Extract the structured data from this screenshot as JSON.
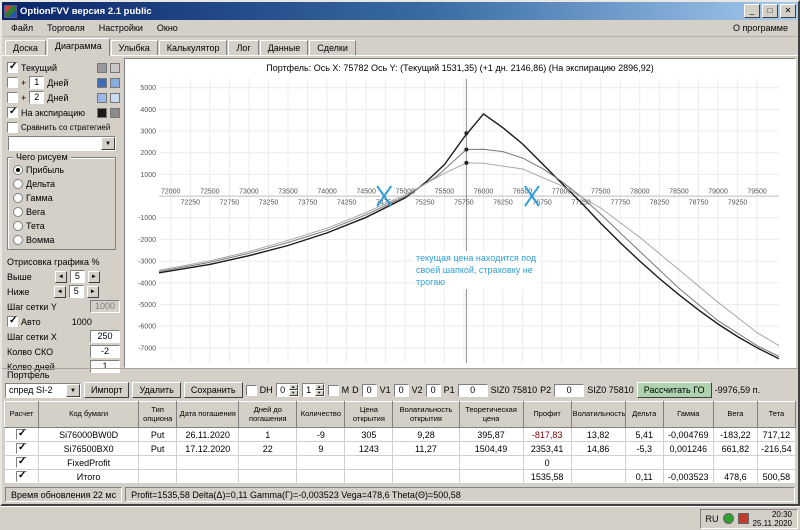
{
  "titlebar": {
    "title": "OptionFVV версия 2.1 public",
    "buttons": {
      "minimize": "_",
      "maximize": "□",
      "close": "✕"
    }
  },
  "menubar": {
    "items": [
      "Файл",
      "Торговля",
      "Настройки",
      "Окно"
    ],
    "right": "О программе"
  },
  "tabs": {
    "items": [
      "Доска",
      "Диаграмма",
      "Улыбка",
      "Калькулятор",
      "Лог",
      "Данные",
      "Сделки"
    ],
    "active": "Диаграмма"
  },
  "sidebar": {
    "rows": {
      "current": {
        "label": "Текущий",
        "checked": true,
        "colors": [
          "#9a9a9a",
          "#c8c8c8"
        ]
      },
      "plus1": {
        "label": "+",
        "value": "1",
        "suffix": "Дней",
        "checked": false,
        "colors": [
          "#3c6cb4",
          "#86aede"
        ]
      },
      "plus2": {
        "label": "+",
        "value": "2",
        "suffix": "Дней",
        "checked": false,
        "colors": [
          "#9ab8e4",
          "#c9dcf3"
        ]
      },
      "expiration": {
        "label": "На экспирацию",
        "checked": true,
        "colors": [
          "#1a1a1a",
          "#8a8a8a"
        ]
      },
      "compare": {
        "label": "Сравнить со стратегией",
        "checked": false
      }
    },
    "draw": {
      "title": "Чего рисуем",
      "options": [
        "Прибыль",
        "Дельта",
        "Гамма",
        "Вега",
        "Тета",
        "Вомма"
      ],
      "selected": "Прибыль"
    },
    "render_pct": {
      "title": "Отрисовка графика %",
      "above": {
        "label": "Выше",
        "value": "5"
      },
      "below": {
        "label": "Ниже",
        "value": "5"
      }
    },
    "grid_y": {
      "label": "Шаг сетки Y",
      "value": "1000"
    },
    "auto": {
      "label": "Авто",
      "checked": true,
      "value": "1000"
    },
    "grid_x": {
      "label": "Шаг сетки X",
      "value": "250"
    },
    "sko": {
      "label": "Колво СКО",
      "value": "-2"
    },
    "days": {
      "label": "Колво дней",
      "value": "1"
    }
  },
  "chart": {
    "title": "Портфель:  Ось X: 75782  Ось Y:   (Текущий 1531,35)   (+1 дн. 2146,86)   (На экспирацию 2896,92)",
    "x_range": [
      71850,
      79780
    ],
    "y_range": [
      -7700,
      5400
    ],
    "x_ticks": {
      "start": 72000,
      "end": 79500,
      "step": 250
    },
    "y_ticks": [
      5000,
      4000,
      3000,
      2000,
      1000,
      -1000,
      -2000,
      -3000,
      -4000,
      -5000,
      -6000,
      -7000
    ],
    "current_x": 75782,
    "cross_marks_x": [
      74730,
      76620
    ],
    "accent_color": "#2e9ed8",
    "annotation": [
      "текущая цена находится под",
      "своей шапкой, страховку не",
      "трогаю"
    ],
    "series": [
      {
        "name": "на экспирацию",
        "color": "#1a1a1a",
        "width": 1.4,
        "points": [
          [
            71850,
            -3540
          ],
          [
            72500,
            -3150
          ],
          [
            73000,
            -2750
          ],
          [
            73500,
            -2280
          ],
          [
            74000,
            -1700
          ],
          [
            74500,
            -980
          ],
          [
            75000,
            -80
          ],
          [
            75250,
            600
          ],
          [
            75500,
            1450
          ],
          [
            75750,
            2700
          ],
          [
            76000,
            3790
          ],
          [
            76250,
            3150
          ],
          [
            76500,
            2400
          ],
          [
            76750,
            1500
          ],
          [
            77000,
            600
          ],
          [
            77250,
            -300
          ],
          [
            77500,
            -1250
          ],
          [
            77750,
            -2150
          ],
          [
            78000,
            -3000
          ],
          [
            78250,
            -3800
          ],
          [
            78500,
            -4550
          ],
          [
            78750,
            -5250
          ],
          [
            79000,
            -5900
          ],
          [
            79250,
            -6480
          ],
          [
            79500,
            -7000
          ],
          [
            79780,
            -7500
          ]
        ]
      },
      {
        "name": "+1 день",
        "color": "#787878",
        "width": 1,
        "points": [
          [
            71850,
            -3480
          ],
          [
            72500,
            -3060
          ],
          [
            73000,
            -2640
          ],
          [
            73500,
            -2140
          ],
          [
            74000,
            -1580
          ],
          [
            74500,
            -860
          ],
          [
            75000,
            -20
          ],
          [
            75400,
            900
          ],
          [
            75782,
            2147
          ],
          [
            76000,
            2160
          ],
          [
            76250,
            2050
          ],
          [
            76500,
            1750
          ],
          [
            76750,
            1280
          ],
          [
            77000,
            680
          ],
          [
            77250,
            -30
          ],
          [
            77500,
            -830
          ],
          [
            78000,
            -2550
          ],
          [
            78500,
            -4250
          ],
          [
            79000,
            -5750
          ],
          [
            79500,
            -6900
          ],
          [
            79780,
            -7400
          ]
        ]
      },
      {
        "name": "текущий",
        "color": "#a8a8a8",
        "width": 1,
        "points": [
          [
            71850,
            -3420
          ],
          [
            72500,
            -2990
          ],
          [
            73000,
            -2560
          ],
          [
            73500,
            -2040
          ],
          [
            74000,
            -1480
          ],
          [
            74500,
            -760
          ],
          [
            75000,
            60
          ],
          [
            75500,
            1050
          ],
          [
            75782,
            1531
          ],
          [
            76000,
            1510
          ],
          [
            76500,
            1250
          ],
          [
            77000,
            480
          ],
          [
            77500,
            -550
          ],
          [
            78000,
            -1900
          ],
          [
            78500,
            -3400
          ],
          [
            79000,
            -4900
          ],
          [
            79500,
            -6300
          ],
          [
            79780,
            -6900
          ]
        ]
      }
    ],
    "dots": [
      [
        75782,
        1531
      ],
      [
        75782,
        2147
      ],
      [
        75782,
        2897
      ]
    ]
  },
  "portfolio": {
    "label": "Портфель",
    "toolbar": {
      "preset": "спред SI-2",
      "import": "Импорт",
      "delete": "Удалить",
      "save": "Сохранить",
      "dh_label": "DH",
      "spin1": "0",
      "spin2": "1",
      "m_label": "M",
      "d_label": "D",
      "d_value": "0",
      "v1_label": "V1",
      "v1_value": "0",
      "v2_label": "V2",
      "v2_value": "0",
      "p1_label": "P1",
      "p1_value": "0",
      "p1_info": "SIZ0 75810",
      "p2_label": "P2",
      "p2_value": "0",
      "p2_info": "SIZ0 75810",
      "calc_go": "Рассчитать ГО",
      "go_value": "-9976,59 п."
    },
    "table": {
      "columns": [
        "Расчет",
        "Код бумаги",
        "Тип опциона",
        "Дата погашения",
        "Дней до погашения",
        "Количество",
        "Цена открытия",
        "Волатильность открытия",
        "Теоретическая цена",
        "Профит",
        "Волатильность",
        "Дельта",
        "Гамма",
        "Вега",
        "Тета"
      ],
      "rows": [
        {
          "checked": true,
          "profit_state": "negative",
          "cells": [
            "Si76000BW0D",
            "Put",
            "26.11.2020",
            "1",
            "-9",
            "305",
            "9,28",
            "395,87",
            "-817,83",
            "13,82",
            "5,41",
            "-0,004769",
            "-183,22",
            "717,12"
          ]
        },
        {
          "checked": true,
          "profit_state": "positive",
          "cells": [
            "Si76500BX0",
            "Put",
            "17.12.2020",
            "22",
            "9",
            "1243",
            "11,27",
            "1504,49",
            "2353,41",
            "14,86",
            "-5,3",
            "0,001246",
            "661,82",
            "-216,54"
          ]
        },
        {
          "checked": true,
          "profit_state": "none",
          "cells": [
            "FixedProfit",
            "",
            "",
            "",
            "",
            "",
            "",
            "",
            "0",
            "",
            "",
            "",
            "",
            ""
          ]
        },
        {
          "checked": true,
          "profit_state": "positive",
          "cells": [
            "Итого",
            "",
            "",
            "",
            "",
            "",
            "",
            "",
            "1535,58",
            "",
            "0,11",
            "-0,003523",
            "478,6",
            "500,58"
          ]
        }
      ]
    }
  },
  "statusbar": {
    "update_time": "Время обновления 22 мс",
    "metrics": "Profit=1535,58  Delta(Δ)=0,11  Gamma(Γ)=-0,003523  Vega=478,6  Theta(Θ)=500,58"
  },
  "taskbar": {
    "lang": "RU",
    "time": "20:30",
    "date": "25.11.2020"
  }
}
